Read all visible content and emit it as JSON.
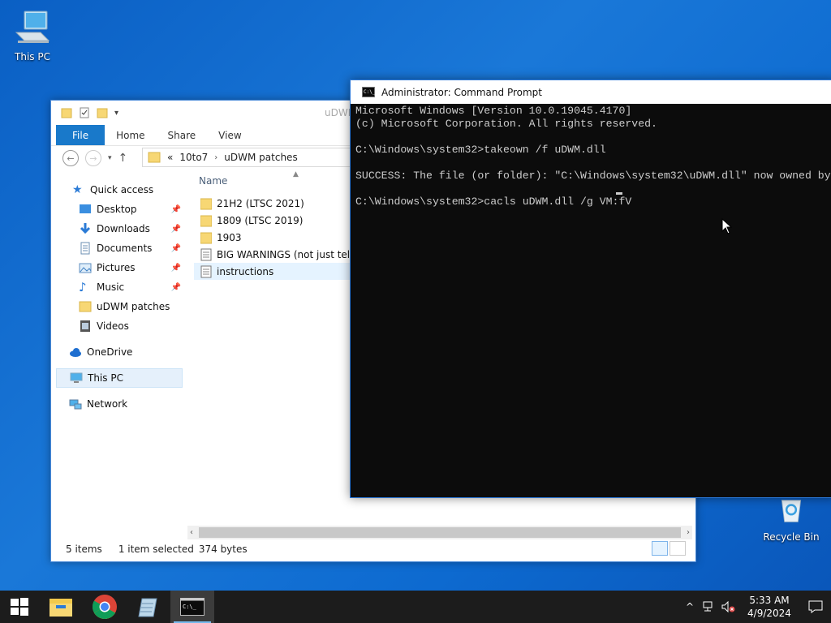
{
  "desktop": {
    "icons": [
      {
        "label": "This PC",
        "icon": "computer-icon"
      },
      {
        "label": "Recycle Bin",
        "icon": "recycle-bin-icon"
      }
    ]
  },
  "explorer": {
    "title_partial": "uDWM",
    "ribbon_tabs": [
      "File",
      "Home",
      "Share",
      "View"
    ],
    "breadcrumb": {
      "overflow": "«",
      "items": [
        "10to7",
        "uDWM patches"
      ]
    },
    "sidebar": [
      {
        "label": "Quick access",
        "icon": "star-icon",
        "pinned": false
      },
      {
        "label": "Desktop",
        "icon": "desktop-icon",
        "pinned": true
      },
      {
        "label": "Downloads",
        "icon": "download-icon",
        "pinned": true
      },
      {
        "label": "Documents",
        "icon": "documents-icon",
        "pinned": true
      },
      {
        "label": "Pictures",
        "icon": "pictures-icon",
        "pinned": true
      },
      {
        "label": "Music",
        "icon": "music-icon",
        "pinned": true
      },
      {
        "label": "uDWM patches",
        "icon": "folder-icon",
        "pinned": false
      },
      {
        "label": "Videos",
        "icon": "videos-icon",
        "pinned": false
      },
      {
        "label": "OneDrive",
        "icon": "cloud-icon",
        "pinned": false
      },
      {
        "label": "This PC",
        "icon": "computer-icon",
        "pinned": false,
        "selected": true
      },
      {
        "label": "Network",
        "icon": "network-icon",
        "pinned": false
      }
    ],
    "column_header": "Name",
    "files": [
      {
        "name": "21H2 (LTSC 2021)",
        "type": "folder"
      },
      {
        "name": "1809 (LTSC 2019)",
        "type": "folder"
      },
      {
        "name": "1903",
        "type": "folder"
      },
      {
        "name": "BIG WARNINGS (not just telling",
        "type": "text"
      },
      {
        "name": "instructions",
        "type": "text",
        "selected": true
      }
    ],
    "status": {
      "items": "5 items",
      "selection": "1 item selected",
      "size": "374 bytes"
    }
  },
  "cmd": {
    "title": "Administrator: Command Prompt",
    "icon_text": "C:\\_",
    "lines": [
      "Microsoft Windows [Version 10.0.19045.4170]",
      "(c) Microsoft Corporation. All rights reserved.",
      "",
      "C:\\Windows\\system32>takeown /f uDWM.dll",
      "",
      "SUCCESS: The file (or folder): \"C:\\Windows\\system32\\uDWM.dll\" now owned by",
      "",
      "C:\\Windows\\system32>cacls uDWM.dll /g VM:fV"
    ]
  },
  "taskbar": {
    "apps": [
      {
        "name": "File Explorer",
        "icon": "file-explorer-icon"
      },
      {
        "name": "Google Chrome",
        "icon": "chrome-icon"
      },
      {
        "name": "Notepad",
        "icon": "notepad-icon"
      },
      {
        "name": "Command Prompt",
        "icon": "cmd-icon",
        "active": true
      }
    ],
    "clock": {
      "time": "5:33 AM",
      "date": "4/9/2024"
    }
  },
  "colors": {
    "accent": "#1979ca",
    "cmd_bg": "#0c0c0c",
    "cmd_text": "#cccccc",
    "taskbar": "#1c1c1c"
  }
}
